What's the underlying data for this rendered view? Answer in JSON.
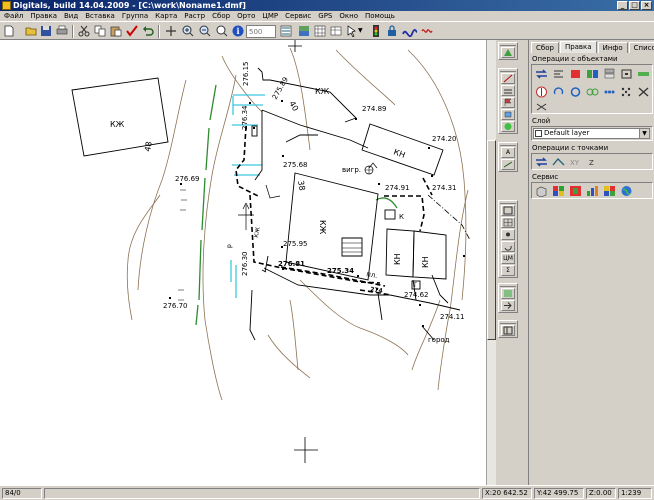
{
  "window": {
    "title": "Digitals, build 14.04.2009 - [C:\\work\\Noname1.dmf]"
  },
  "menu": [
    "Файл",
    "Правка",
    "Вид",
    "Вставка",
    "Группа",
    "Карта",
    "Растр",
    "Сбор",
    "Орто",
    "ЦМР",
    "Сервис",
    "GPS",
    "Окно",
    "Помощь"
  ],
  "toolbar": {
    "scale_placeholder": "500"
  },
  "map": {
    "labels": {
      "kzh1": "КЖ",
      "num48": "48",
      "kzh_top": "КЖ",
      "num40": "40",
      "kn_top": "КН",
      "kzh_mid": "КЖ",
      "num38": "38",
      "kn_a": "КН",
      "kn_b": "КН",
      "kzh_low": "КЖ",
      "vigr": "вигр.",
      "k": "К",
      "pl": "пл.",
      "gorod": "город",
      "t": "Т",
      "p": "р",
      "h1": "276.15",
      "h2": "275.89",
      "h3": "274.89",
      "h4": "276.34",
      "h5": "274.20",
      "h6": "275.68",
      "h7": "274.91",
      "h8": "274.31",
      "h9": "276.69",
      "h10": "275.95",
      "h11": "276.81",
      "h12": "275.34",
      "h13": "276.30",
      "h14": "274.62",
      "h15": "274.11",
      "h16": "276.70",
      "h17": "274"
    }
  },
  "panel": {
    "tabs": [
      "Сбор",
      "Правка",
      "Инфо",
      "Список"
    ],
    "active_tab": "Правка",
    "sections": {
      "objects": "Операции с объектами",
      "layer": "Слой",
      "points": "Операции с точками",
      "service": "Сервис"
    },
    "layer_value": "Default layer"
  },
  "status": {
    "count": "84/0",
    "x": "X:20 642.52",
    "y": "Y:42 499.75",
    "z": "Z:0.00",
    "scale": "1:239"
  },
  "colors": {
    "accent": "#0a246a",
    "contour": "#8b7355",
    "green_line": "#2e8b2e",
    "cyan_line": "#3cc8e0",
    "red_check": "#cc0000"
  }
}
